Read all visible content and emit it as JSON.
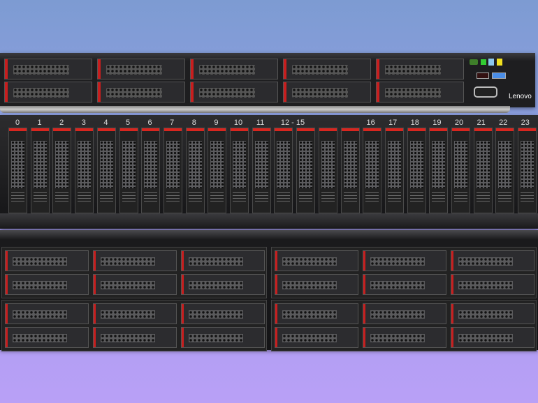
{
  "top_server": {
    "brand": "Lenovo"
  },
  "middle_server": {
    "bay_labels": [
      "0",
      "1",
      "2",
      "3",
      "4",
      "5",
      "6",
      "7",
      "8",
      "9",
      "10",
      "11",
      "12 - 15",
      "16",
      "17",
      "18",
      "19",
      "20",
      "21",
      "22",
      "23"
    ]
  }
}
